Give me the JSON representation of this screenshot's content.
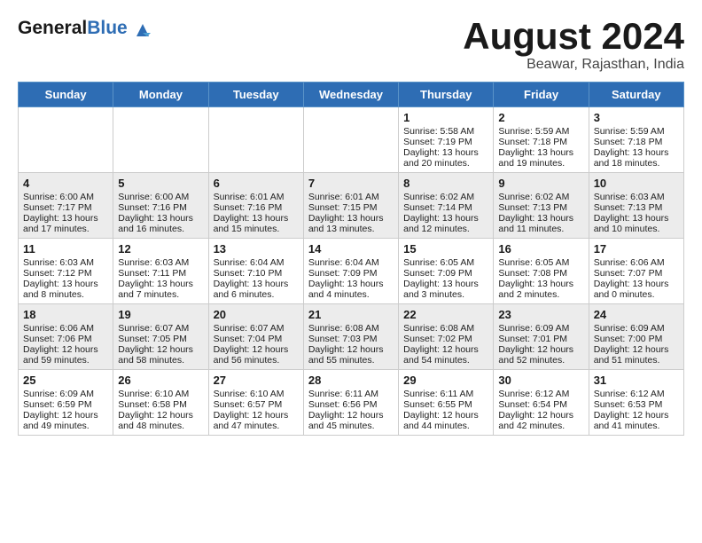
{
  "logo": {
    "general": "General",
    "blue": "Blue"
  },
  "title": "August 2024",
  "location": "Beawar, Rajasthan, India",
  "days_header": [
    "Sunday",
    "Monday",
    "Tuesday",
    "Wednesday",
    "Thursday",
    "Friday",
    "Saturday"
  ],
  "weeks": [
    [
      {
        "day": "",
        "info": ""
      },
      {
        "day": "",
        "info": ""
      },
      {
        "day": "",
        "info": ""
      },
      {
        "day": "",
        "info": ""
      },
      {
        "day": "1",
        "info": "Sunrise: 5:58 AM\nSunset: 7:19 PM\nDaylight: 13 hours\nand 20 minutes."
      },
      {
        "day": "2",
        "info": "Sunrise: 5:59 AM\nSunset: 7:18 PM\nDaylight: 13 hours\nand 19 minutes."
      },
      {
        "day": "3",
        "info": "Sunrise: 5:59 AM\nSunset: 7:18 PM\nDaylight: 13 hours\nand 18 minutes."
      }
    ],
    [
      {
        "day": "4",
        "info": "Sunrise: 6:00 AM\nSunset: 7:17 PM\nDaylight: 13 hours\nand 17 minutes."
      },
      {
        "day": "5",
        "info": "Sunrise: 6:00 AM\nSunset: 7:16 PM\nDaylight: 13 hours\nand 16 minutes."
      },
      {
        "day": "6",
        "info": "Sunrise: 6:01 AM\nSunset: 7:16 PM\nDaylight: 13 hours\nand 15 minutes."
      },
      {
        "day": "7",
        "info": "Sunrise: 6:01 AM\nSunset: 7:15 PM\nDaylight: 13 hours\nand 13 minutes."
      },
      {
        "day": "8",
        "info": "Sunrise: 6:02 AM\nSunset: 7:14 PM\nDaylight: 13 hours\nand 12 minutes."
      },
      {
        "day": "9",
        "info": "Sunrise: 6:02 AM\nSunset: 7:13 PM\nDaylight: 13 hours\nand 11 minutes."
      },
      {
        "day": "10",
        "info": "Sunrise: 6:03 AM\nSunset: 7:13 PM\nDaylight: 13 hours\nand 10 minutes."
      }
    ],
    [
      {
        "day": "11",
        "info": "Sunrise: 6:03 AM\nSunset: 7:12 PM\nDaylight: 13 hours\nand 8 minutes."
      },
      {
        "day": "12",
        "info": "Sunrise: 6:03 AM\nSunset: 7:11 PM\nDaylight: 13 hours\nand 7 minutes."
      },
      {
        "day": "13",
        "info": "Sunrise: 6:04 AM\nSunset: 7:10 PM\nDaylight: 13 hours\nand 6 minutes."
      },
      {
        "day": "14",
        "info": "Sunrise: 6:04 AM\nSunset: 7:09 PM\nDaylight: 13 hours\nand 4 minutes."
      },
      {
        "day": "15",
        "info": "Sunrise: 6:05 AM\nSunset: 7:09 PM\nDaylight: 13 hours\nand 3 minutes."
      },
      {
        "day": "16",
        "info": "Sunrise: 6:05 AM\nSunset: 7:08 PM\nDaylight: 13 hours\nand 2 minutes."
      },
      {
        "day": "17",
        "info": "Sunrise: 6:06 AM\nSunset: 7:07 PM\nDaylight: 13 hours\nand 0 minutes."
      }
    ],
    [
      {
        "day": "18",
        "info": "Sunrise: 6:06 AM\nSunset: 7:06 PM\nDaylight: 12 hours\nand 59 minutes."
      },
      {
        "day": "19",
        "info": "Sunrise: 6:07 AM\nSunset: 7:05 PM\nDaylight: 12 hours\nand 58 minutes."
      },
      {
        "day": "20",
        "info": "Sunrise: 6:07 AM\nSunset: 7:04 PM\nDaylight: 12 hours\nand 56 minutes."
      },
      {
        "day": "21",
        "info": "Sunrise: 6:08 AM\nSunset: 7:03 PM\nDaylight: 12 hours\nand 55 minutes."
      },
      {
        "day": "22",
        "info": "Sunrise: 6:08 AM\nSunset: 7:02 PM\nDaylight: 12 hours\nand 54 minutes."
      },
      {
        "day": "23",
        "info": "Sunrise: 6:09 AM\nSunset: 7:01 PM\nDaylight: 12 hours\nand 52 minutes."
      },
      {
        "day": "24",
        "info": "Sunrise: 6:09 AM\nSunset: 7:00 PM\nDaylight: 12 hours\nand 51 minutes."
      }
    ],
    [
      {
        "day": "25",
        "info": "Sunrise: 6:09 AM\nSunset: 6:59 PM\nDaylight: 12 hours\nand 49 minutes."
      },
      {
        "day": "26",
        "info": "Sunrise: 6:10 AM\nSunset: 6:58 PM\nDaylight: 12 hours\nand 48 minutes."
      },
      {
        "day": "27",
        "info": "Sunrise: 6:10 AM\nSunset: 6:57 PM\nDaylight: 12 hours\nand 47 minutes."
      },
      {
        "day": "28",
        "info": "Sunrise: 6:11 AM\nSunset: 6:56 PM\nDaylight: 12 hours\nand 45 minutes."
      },
      {
        "day": "29",
        "info": "Sunrise: 6:11 AM\nSunset: 6:55 PM\nDaylight: 12 hours\nand 44 minutes."
      },
      {
        "day": "30",
        "info": "Sunrise: 6:12 AM\nSunset: 6:54 PM\nDaylight: 12 hours\nand 42 minutes."
      },
      {
        "day": "31",
        "info": "Sunrise: 6:12 AM\nSunset: 6:53 PM\nDaylight: 12 hours\nand 41 minutes."
      }
    ]
  ]
}
